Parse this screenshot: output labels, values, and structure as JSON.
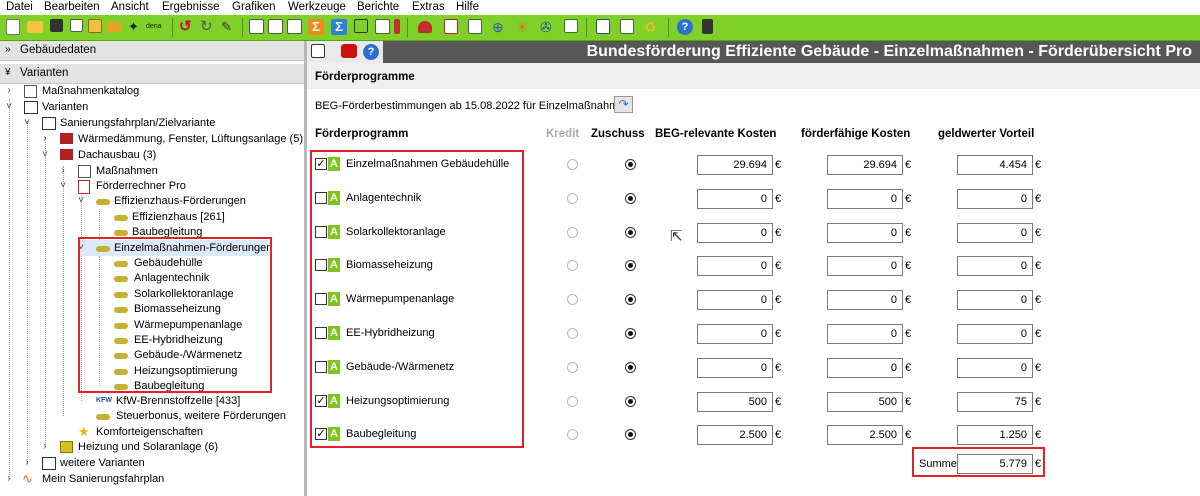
{
  "menu": [
    "Datei",
    "Bearbeiten",
    "Ansicht",
    "Ergebnisse",
    "Grafiken",
    "Werkzeuge",
    "Berichte",
    "Extras",
    "Hilfe"
  ],
  "toolbar": {
    "dena_label": "dena",
    "icons": [
      "new-file-icon",
      "open-folder-icon",
      "save-icon",
      "copy-icon",
      "paste-icon",
      "export-icon",
      "wizard-icon",
      "dena-icon",
      "undo-icon",
      "redo-icon",
      "settings-icon",
      "building-icon",
      "report-icon",
      "sum-icon",
      "sum-blue-icon",
      "tree-icon",
      "list-icon",
      "heating-icon",
      "chart-icon",
      "image-icon",
      "calendar-icon",
      "sun-icon",
      "wind-icon",
      "house-icon",
      "document-icon",
      "table-icon",
      "recycle-icon",
      "help-icon",
      "calculator-icon"
    ]
  },
  "left": {
    "gebaeudedaten": "Gebäudedaten",
    "varianten_header": "Varianten",
    "tree": {
      "massnahmenkatalog": "Maßnahmenkatalog",
      "varianten": "Varianten",
      "sanierungsfahrplan": "Sanierungsfahrplan/Zielvariante",
      "waermedaemmung": "Wärmedämmung, Fenster, Lüftungsanlage (5)",
      "dachausbau": "Dachausbau (3)",
      "massnahmen": "Maßnahmen",
      "foerderrechner": "Förderrechner Pro",
      "effizienzhaus_foerderungen": "Effizienzhaus-Förderungen",
      "effizienzhaus": "Effizienzhaus [261]",
      "baubegleitung1": "Baubegleitung",
      "einzelmassnahmen": "Einzelmaßnahmen-Förderungen",
      "sub": [
        "Gebäudehülle",
        "Anlagentechnik",
        "Solarkollektoranlage",
        "Biomasseheizung",
        "Wärmepumpenanlage",
        "EE-Hybridheizung",
        "Gebäude-/Wärmenetz",
        "Heizungsoptimierung",
        "Baubegleitung"
      ],
      "kfw_prefix": "KFW",
      "kfw": "KfW-Brennstoffzelle [433]",
      "steuerbonus": "Steuerbonus, weitere Förderungen",
      "komfort": "Komforteigenschaften",
      "heizung_solar": "Heizung und Solaranlage (6)",
      "weitere": "weitere Varianten",
      "mein": "Mein Sanierungsfahrplan"
    }
  },
  "header": {
    "title": "Bundesförderung Effiziente Gebäude - Einzelmaßnahmen - Förderübersicht Pro"
  },
  "main": {
    "section_title": "Förderprogramme",
    "beg_text": "BEG-Förderbestimmungen ab 15.08.2022 für Einzelmaßnahmen",
    "columns": {
      "programm": "Förderprogramm",
      "kredit": "Kredit",
      "zuschuss": "Zuschuss",
      "beg": "BEG-relevante Kosten",
      "foerderfaehig": "förderfähige Kosten",
      "vorteil": "geldwerter Vorteil"
    },
    "currency": "€",
    "badge": "A",
    "rows": [
      {
        "name": "Einzelmaßnahmen Gebäudehülle",
        "checked": true,
        "beg": "29.694",
        "ff": "29.694",
        "gv": "4.454"
      },
      {
        "name": "Anlagentechnik",
        "checked": false,
        "beg": "0",
        "ff": "0",
        "gv": "0"
      },
      {
        "name": "Solarkollektoranlage",
        "checked": false,
        "beg": "0",
        "ff": "0",
        "gv": "0"
      },
      {
        "name": "Biomasseheizung",
        "checked": false,
        "beg": "0",
        "ff": "0",
        "gv": "0"
      },
      {
        "name": "Wärmepumpenanlage",
        "checked": false,
        "beg": "0",
        "ff": "0",
        "gv": "0"
      },
      {
        "name": "EE-Hybridheizung",
        "checked": false,
        "beg": "0",
        "ff": "0",
        "gv": "0"
      },
      {
        "name": "Gebäude-/Wärmenetz",
        "checked": false,
        "beg": "0",
        "ff": "0",
        "gv": "0"
      },
      {
        "name": "Heizungsoptimierung",
        "checked": true,
        "beg": "500",
        "ff": "500",
        "gv": "75"
      },
      {
        "name": "Baubegleitung",
        "checked": true,
        "beg": "2.500",
        "ff": "2.500",
        "gv": "1.250"
      }
    ],
    "summe_label": "Summe",
    "summe_value": "5.779"
  },
  "colors": {
    "toolbar": "#7fd12a",
    "title_bg": "#575757",
    "highlight": "#e0202a",
    "badge": "#7fc51f"
  }
}
